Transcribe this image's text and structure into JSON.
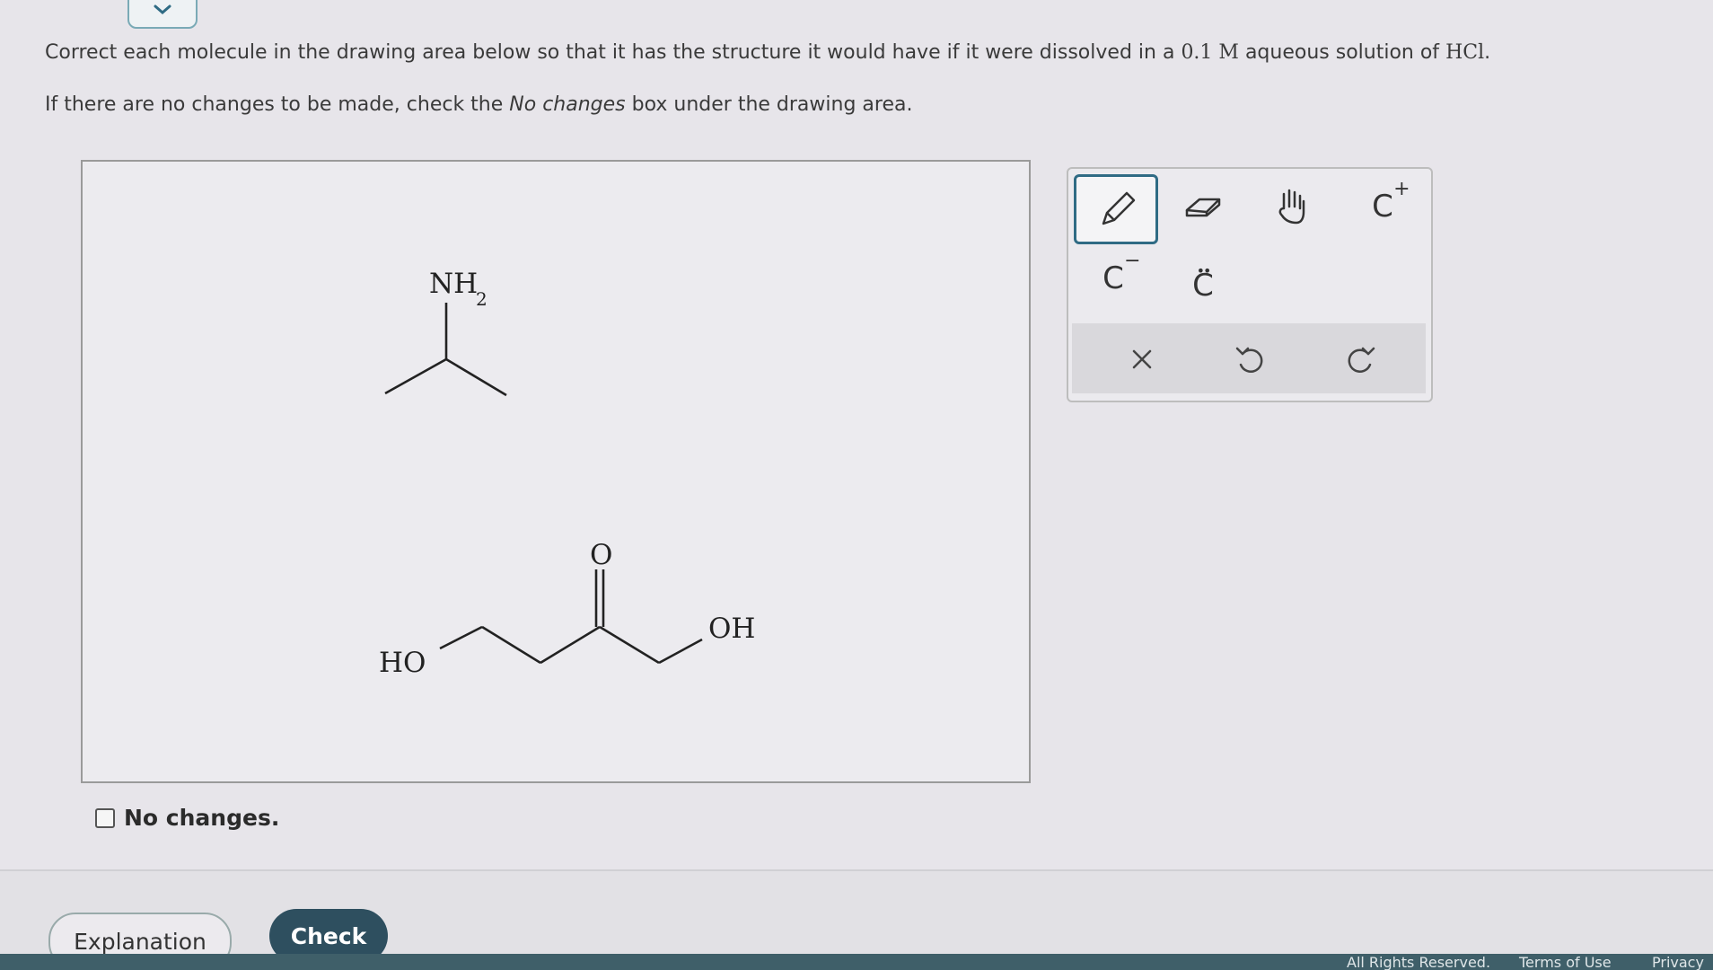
{
  "prompt": {
    "line1_prefix": "Correct each molecule in the drawing area below so that it has the structure it would have if it were dissolved in a",
    "concentration": "0.1 M",
    "line1_mid": "aqueous solution of",
    "acid": "HCl",
    "line1_end": ".",
    "line2_prefix": "If there are no changes to be made, check the",
    "line2_em": "No changes",
    "line2_suffix": "box under the drawing area."
  },
  "molecules": {
    "amine": {
      "nh": "NH",
      "sub": "2"
    },
    "acid": {
      "carbonyl_o": "O",
      "oh": "OH",
      "ho": "HO"
    }
  },
  "toolbar": {
    "tools": [
      {
        "id": "pencil",
        "icon": "pencil-icon",
        "selected": true
      },
      {
        "id": "eraser",
        "icon": "eraser-icon"
      },
      {
        "id": "hand",
        "icon": "hand-icon"
      },
      {
        "id": "cation",
        "label": "C",
        "sup": "+"
      },
      {
        "id": "anion",
        "label": "C",
        "sup": "−"
      },
      {
        "id": "lone-pair",
        "label": "C",
        "dots": "••"
      }
    ],
    "actions": [
      {
        "id": "clear",
        "icon": "x-icon"
      },
      {
        "id": "undo",
        "icon": "undo-icon"
      },
      {
        "id": "redo",
        "icon": "redo-icon"
      }
    ]
  },
  "no_changes_label": "No changes.",
  "buttons": {
    "explanation": "Explanation",
    "check": "Check"
  },
  "footer": {
    "rights": "All Rights Reserved.",
    "terms": "Terms of Use",
    "privacy": "Privacy"
  },
  "colors": {
    "accent": "#2e4f5f",
    "selected_border": "#2f6b84",
    "footer_bar": "#3f5f69"
  }
}
